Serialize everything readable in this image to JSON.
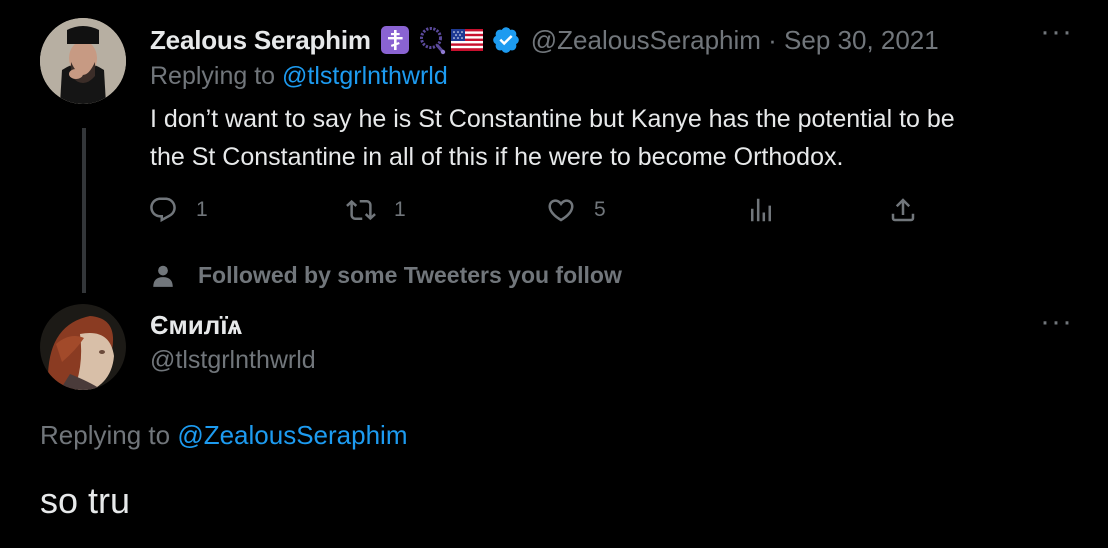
{
  "tweet1": {
    "display_name": "Zealous Seraphim",
    "handle_and_date": "@ZealousSeraphim · Sep 30, 2021",
    "replying_prefix": "Replying to ",
    "replying_handle": "@tlstgrlnthwrld",
    "text_line1": "I don’t want to say he is St Constantine but Kanye has the potential to be",
    "text_line2": "the St Constantine in all of this if he were to become Orthodox.",
    "replies": "1",
    "retweets": "1",
    "likes": "5",
    "more": "···",
    "icons": [
      "orthodox-cross-badge-icon",
      "prayer-rope-icon",
      "us-flag-icon",
      "verified-badge-icon",
      "reply-icon",
      "retweet-icon",
      "like-icon",
      "views-icon",
      "share-icon"
    ]
  },
  "followed_by": "Followed by some Tweeters you follow",
  "tweet2": {
    "display_name": "Ємилїѧ",
    "handle": "@tlstgrlnthwrld",
    "replying_prefix": "Replying to ",
    "replying_handle": "@ZealousSeraphim",
    "text": "so tru",
    "more": "···"
  },
  "colors": {
    "background": "#000000",
    "text": "#e7e9ea",
    "muted": "#71767b",
    "link": "#1d9bf0",
    "thread_line": "#333639",
    "badge_purple": "#8a63d2"
  }
}
